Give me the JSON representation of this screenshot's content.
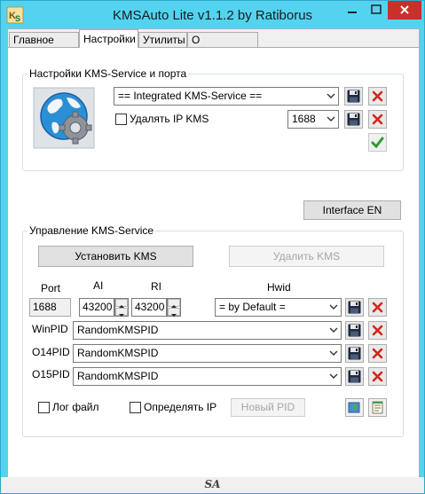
{
  "window": {
    "title": "KMSAuto Lite v1.1.2 by Ratiborus",
    "accent_color": "#53d3f0",
    "close_color": "#c7302b"
  },
  "tabs": [
    {
      "label": "Главное окно",
      "active": false
    },
    {
      "label": "Настройки",
      "active": true
    },
    {
      "label": "Утилиты",
      "active": false
    },
    {
      "label": "О Программе",
      "active": false
    }
  ],
  "kms_settings": {
    "group_title": "Настройки KMS-Service и порта",
    "service_value": "== Integrated KMS-Service ==",
    "delete_ip_label": "Удалять IP KMS",
    "delete_ip_checked": false,
    "port_value": "1688"
  },
  "interface_button": "Interface EN",
  "kms_management": {
    "group_title": "Управление KMS-Service",
    "install_button": "Установить KMS",
    "remove_button": "Удалить KMS",
    "headers": {
      "port": "Port",
      "ai": "AI",
      "ri": "RI",
      "hwid": "Hwid"
    },
    "port_value": "1688",
    "ai_value": "43200",
    "ri_value": "43200",
    "hwid_value": "= by Default =",
    "pid_rows": [
      {
        "label": "WinPID",
        "value": "RandomKMSPID"
      },
      {
        "label": "O14PID",
        "value": "RandomKMSPID"
      },
      {
        "label": "O15PID",
        "value": "RandomKMSPID"
      }
    ],
    "log_file_label": "Лог файл",
    "log_file_checked": false,
    "detect_ip_label": "Определять IP",
    "detect_ip_checked": false,
    "new_pid_button": "Новый PID"
  },
  "footer": {
    "signature": "SA"
  },
  "icons": {
    "app": "kms-logo-icon",
    "globe_gear": "globe-gear-icon",
    "save": "floppy-disk-icon",
    "delete": "red-x-icon",
    "apply": "green-checkmark-icon",
    "dropdown": "chevron-down-icon"
  }
}
